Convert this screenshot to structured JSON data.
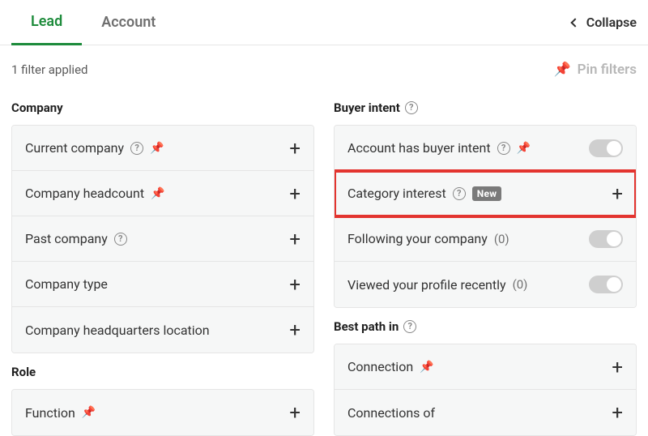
{
  "tabs": {
    "lead": "Lead",
    "account": "Account"
  },
  "collapse_label": "Collapse",
  "filter_count_text": "1 filter applied",
  "pin_filters_label": "Pin filters",
  "sections": {
    "company": {
      "title": "Company",
      "items": [
        {
          "label": "Current company",
          "help": true,
          "pin": true,
          "action": "plus"
        },
        {
          "label": "Company headcount",
          "help": false,
          "pin": true,
          "action": "plus"
        },
        {
          "label": "Past company",
          "help": true,
          "pin": false,
          "action": "plus"
        },
        {
          "label": "Company type",
          "help": false,
          "pin": false,
          "action": "plus"
        },
        {
          "label": "Company headquarters location",
          "help": false,
          "pin": false,
          "action": "plus"
        }
      ]
    },
    "role": {
      "title": "Role",
      "items": [
        {
          "label": "Function",
          "help": false,
          "pin": true,
          "action": "plus"
        }
      ]
    },
    "buyer_intent": {
      "title": "Buyer intent",
      "title_help": true,
      "items": [
        {
          "label": "Account has buyer intent",
          "help": true,
          "pin": true,
          "action": "toggle"
        },
        {
          "label": "Category interest",
          "help": true,
          "badge": "New",
          "action": "plus",
          "highlight": true
        },
        {
          "label": "Following your company",
          "count": "(0)",
          "action": "toggle"
        },
        {
          "label": "Viewed your profile recently",
          "count": "(0)",
          "action": "toggle"
        }
      ]
    },
    "best_path": {
      "title": "Best path in",
      "title_help": true,
      "items": [
        {
          "label": "Connection",
          "pin": true,
          "action": "plus"
        },
        {
          "label": "Connections of",
          "action": "plus"
        }
      ]
    }
  }
}
